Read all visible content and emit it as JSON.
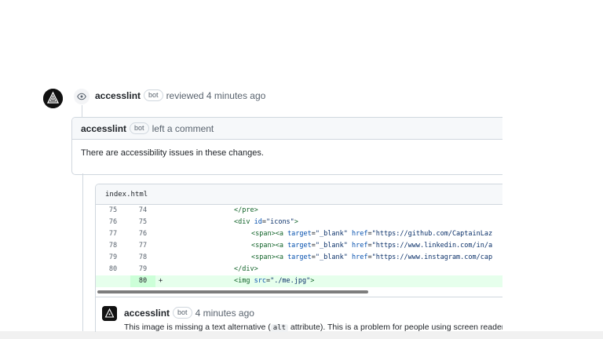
{
  "review": {
    "author": "accesslint",
    "badge": "bot",
    "action": "reviewed 4 minutes ago",
    "icon": "eye-icon"
  },
  "comment_box": {
    "author": "accesslint",
    "badge": "bot",
    "action": "left a comment",
    "body": "There are accessibility issues in these changes."
  },
  "file": {
    "name": "index.html",
    "lines": [
      {
        "old": "75",
        "new": "74",
        "marker": "",
        "indent": 1,
        "parts": [
          [
            "tag",
            "</pre>"
          ]
        ]
      },
      {
        "old": "76",
        "new": "75",
        "marker": "",
        "indent": 1,
        "parts": [
          [
            "tag",
            "<div "
          ],
          [
            "attr",
            "id"
          ],
          [
            "punct",
            "="
          ],
          [
            "str",
            "\"icons\""
          ],
          [
            "tag",
            ">"
          ]
        ]
      },
      {
        "old": "77",
        "new": "76",
        "marker": "",
        "indent": 2,
        "parts": [
          [
            "tag",
            "<span><a "
          ],
          [
            "attr",
            "target"
          ],
          [
            "punct",
            "="
          ],
          [
            "str",
            "\"_blank\""
          ],
          [
            "punct",
            " "
          ],
          [
            "attr",
            "href"
          ],
          [
            "punct",
            "="
          ],
          [
            "str",
            "\"https://github.com/CaptainLaz"
          ]
        ]
      },
      {
        "old": "78",
        "new": "77",
        "marker": "",
        "indent": 2,
        "parts": [
          [
            "tag",
            "<span><a "
          ],
          [
            "attr",
            "target"
          ],
          [
            "punct",
            "="
          ],
          [
            "str",
            "\"_blank\""
          ],
          [
            "punct",
            " "
          ],
          [
            "attr",
            "href"
          ],
          [
            "punct",
            "="
          ],
          [
            "str",
            "\"https://www.linkedin.com/in/a"
          ]
        ]
      },
      {
        "old": "79",
        "new": "78",
        "marker": "",
        "indent": 2,
        "parts": [
          [
            "tag",
            "<span><a "
          ],
          [
            "attr",
            "target"
          ],
          [
            "punct",
            "="
          ],
          [
            "str",
            "\"_blank\""
          ],
          [
            "punct",
            " "
          ],
          [
            "attr",
            "href"
          ],
          [
            "punct",
            "="
          ],
          [
            "str",
            "\"https://www.instagram.com/cap"
          ]
        ]
      },
      {
        "old": "80",
        "new": "79",
        "marker": "",
        "indent": 1,
        "parts": [
          [
            "tag",
            "</div>"
          ]
        ]
      },
      {
        "old": "",
        "new": "80",
        "marker": "+",
        "indent": 1,
        "added": true,
        "parts": [
          [
            "tag",
            "<img "
          ],
          [
            "attr",
            "src"
          ],
          [
            "punct",
            "="
          ],
          [
            "str",
            "\"./me.jpg\""
          ],
          [
            "tag",
            ">"
          ]
        ]
      }
    ]
  },
  "inline_comment": {
    "author": "accesslint",
    "badge": "bot",
    "time": "4 minutes ago",
    "text_before": "This image is missing a text alternative (",
    "code": "alt",
    "text_after": " attribute). This is a problem for people using screen readers"
  },
  "colors": {
    "added_bg": "#e6ffec",
    "added_ln_bg": "#ccffd8",
    "tag": "#116329",
    "attr": "#0550ae",
    "string": "#0a3069"
  }
}
